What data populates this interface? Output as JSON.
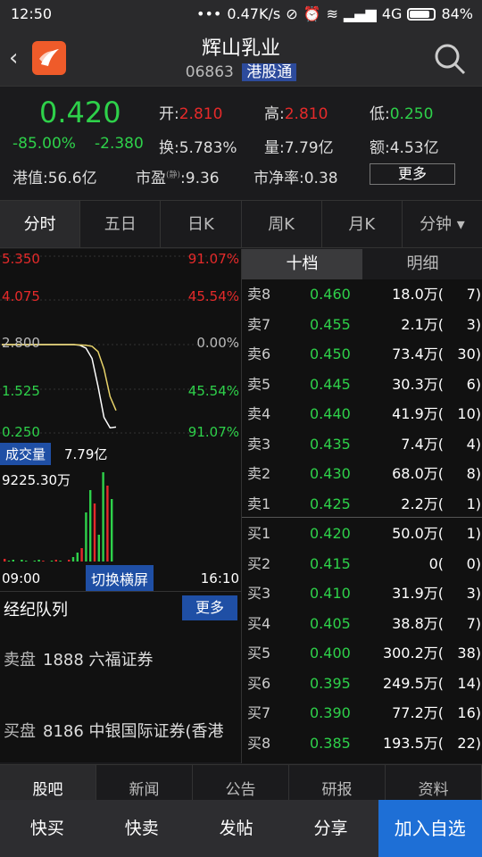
{
  "status": {
    "time": "12:50",
    "network_speed": "0.47K/s",
    "signal": "4G",
    "battery": "84%",
    "dots": "•••"
  },
  "header": {
    "back_icon": "‹",
    "title": "辉山乳业",
    "code": "06863",
    "badge": "港股通"
  },
  "quote": {
    "price": "0.420",
    "change_pct": "-85.00%",
    "change": "-2.380",
    "open_label": "开:",
    "open": "2.810",
    "high_label": "高:",
    "high": "2.810",
    "low_label": "低:",
    "low": "0.250",
    "turnover_label": "换:",
    "turnover": "5.783%",
    "volume_label": "量:",
    "volume": "7.79亿",
    "amount_label": "额:",
    "amount": "4.53亿",
    "mktcap_label": "港值:",
    "mktcap": "56.6亿",
    "pe_label": "市盈",
    "pe_sup": "(静)",
    "pe": ":9.36",
    "pb_label": "市净率:",
    "pb": "0.38",
    "more": "更多"
  },
  "tabs": [
    "分时",
    "五日",
    "日K",
    "周K",
    "月K",
    "分钟 ▾"
  ],
  "chart": {
    "y_left": [
      "5.350",
      "4.075",
      "2.800",
      "1.525",
      "0.250"
    ],
    "y_right": [
      "91.07%",
      "45.54%",
      "0.00%",
      "45.54%",
      "91.07%"
    ],
    "vol_label": "成交量",
    "vol_value": "7.79亿",
    "vol_max": "9225.30万",
    "time_start": "09:00",
    "time_end": "16:10",
    "landscape": "切换横屏"
  },
  "chart_data": {
    "type": "line",
    "ylim": [
      0.25,
      5.35
    ],
    "series": [
      {
        "values": [
          2.8,
          2.8,
          2.8,
          2.8,
          2.8,
          2.8,
          2.8,
          2.8,
          2.8,
          2.8,
          2.8,
          2.8,
          2.8,
          2.78,
          2.7,
          2.4,
          1.6,
          0.7,
          0.4,
          0.42
        ]
      },
      {
        "values": [
          2.8,
          2.8,
          2.8,
          2.8,
          2.8,
          2.8,
          2.8,
          2.8,
          2.8,
          2.8,
          2.8,
          2.8,
          2.8,
          2.79,
          2.78,
          2.75,
          2.6,
          2.1,
          1.3,
          0.9
        ]
      }
    ],
    "volume": [
      0.03,
      0.01,
      0.02,
      0.0,
      0.02,
      0.01,
      0.0,
      0.01,
      0.02,
      0.01,
      0.0,
      0.01,
      0.02,
      0.01,
      0.0,
      0.02,
      0.05,
      0.1,
      0.15,
      0.55,
      0.8,
      0.65,
      0.3,
      1.0,
      0.85,
      0.7
    ]
  },
  "broker": {
    "title": "经纪队列",
    "more": "更多",
    "sell_label": "卖盘",
    "sell_value": "1888 六福证券",
    "buy_label": "买盘",
    "buy_value": "8186 中银国际证券(香港"
  },
  "orderbook": {
    "tabs": [
      "十档",
      "明细"
    ],
    "asks": [
      {
        "lvl": "卖8",
        "px": "0.460",
        "vol": "18.0万(",
        "cnt": "7)"
      },
      {
        "lvl": "卖7",
        "px": "0.455",
        "vol": "2.1万(",
        "cnt": "3)"
      },
      {
        "lvl": "卖6",
        "px": "0.450",
        "vol": "73.4万(",
        "cnt": "30)"
      },
      {
        "lvl": "卖5",
        "px": "0.445",
        "vol": "30.3万(",
        "cnt": "6)"
      },
      {
        "lvl": "卖4",
        "px": "0.440",
        "vol": "41.9万(",
        "cnt": "10)"
      },
      {
        "lvl": "卖3",
        "px": "0.435",
        "vol": "7.4万(",
        "cnt": "4)"
      },
      {
        "lvl": "卖2",
        "px": "0.430",
        "vol": "68.0万(",
        "cnt": "8)"
      },
      {
        "lvl": "卖1",
        "px": "0.425",
        "vol": "2.2万(",
        "cnt": "1)"
      }
    ],
    "bids": [
      {
        "lvl": "买1",
        "px": "0.420",
        "vol": "50.0万(",
        "cnt": "1)"
      },
      {
        "lvl": "买2",
        "px": "0.415",
        "vol": "0(",
        "cnt": "0)"
      },
      {
        "lvl": "买3",
        "px": "0.410",
        "vol": "31.9万(",
        "cnt": "3)"
      },
      {
        "lvl": "买4",
        "px": "0.405",
        "vol": "38.8万(",
        "cnt": "7)"
      },
      {
        "lvl": "买5",
        "px": "0.400",
        "vol": "300.2万(",
        "cnt": "38)"
      },
      {
        "lvl": "买6",
        "px": "0.395",
        "vol": "249.5万(",
        "cnt": "14)"
      },
      {
        "lvl": "买7",
        "px": "0.390",
        "vol": "77.2万(",
        "cnt": "16)"
      },
      {
        "lvl": "买8",
        "px": "0.385",
        "vol": "193.5万(",
        "cnt": "22)"
      }
    ]
  },
  "news_tabs": [
    "股吧",
    "新闻",
    "公告",
    "研报",
    "资料"
  ],
  "bottom": [
    "快买",
    "快卖",
    "发帖",
    "分享",
    "加入自选"
  ],
  "colors": {
    "up": "#e52a2a",
    "down": "#2ed14a",
    "accent": "#1e6fd6"
  }
}
